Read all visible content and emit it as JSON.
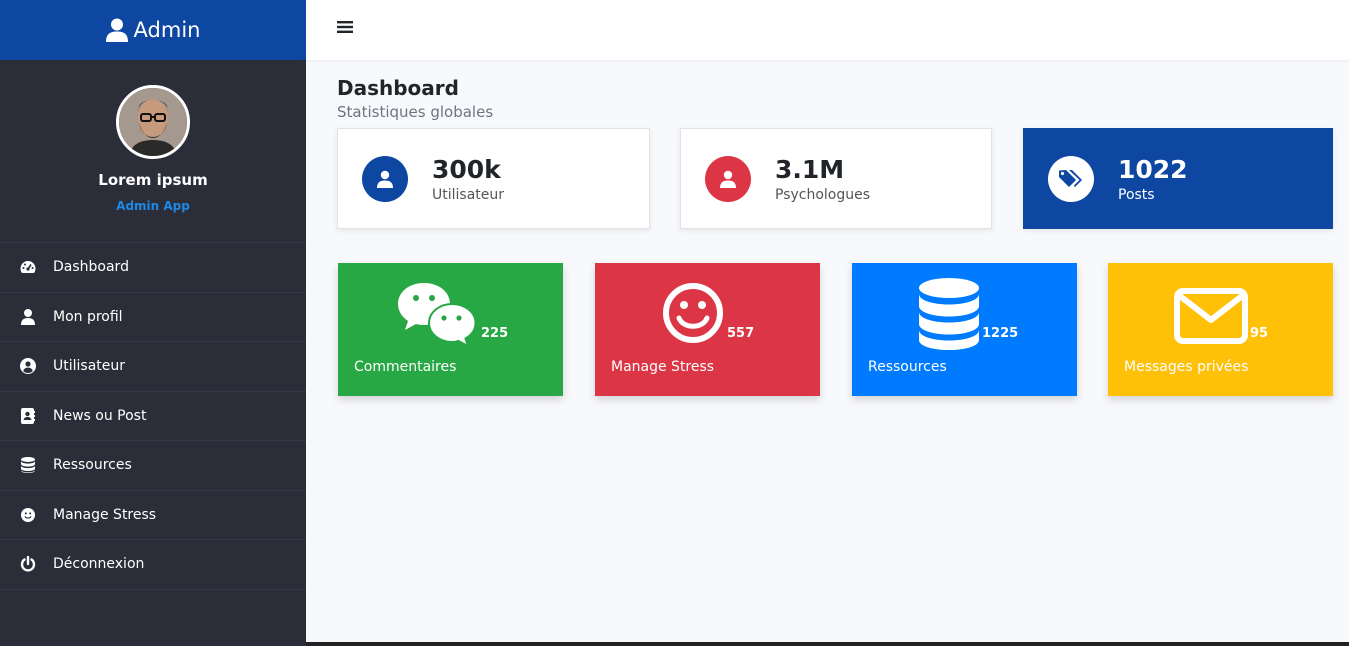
{
  "brand": {
    "title": "Admin",
    "color": "#0d47a1"
  },
  "profile": {
    "name": "Lorem ipsum",
    "role": "Admin App"
  },
  "menu": [
    {
      "label": "Dashboard",
      "icon": "tachometer-icon"
    },
    {
      "label": "Mon profil",
      "icon": "user-icon"
    },
    {
      "label": "Utilisateur",
      "icon": "user-circle-icon"
    },
    {
      "label": "News ou Post",
      "icon": "address-book-icon"
    },
    {
      "label": "Ressources",
      "icon": "database-icon"
    },
    {
      "label": "Manage Stress",
      "icon": "smile-icon"
    },
    {
      "label": "Déconnexion",
      "icon": "power-icon"
    }
  ],
  "header": {
    "title": "Dashboard",
    "subtitle": "Statistiques globales"
  },
  "stats": [
    {
      "value": "300k",
      "label": "Utilisateur",
      "icon": "user-icon",
      "color": "#0d47a1"
    },
    {
      "value": "3.1M",
      "label": "Psychologues",
      "icon": "user-icon",
      "color": "#dc3545"
    },
    {
      "value": "1022",
      "label": "Posts",
      "icon": "tags-icon",
      "color": "#0d47a1"
    }
  ],
  "tiles": [
    {
      "label": "Commentaires",
      "count": "225",
      "icon": "chat-bubbles-icon",
      "color": "#28a745"
    },
    {
      "label": "Manage Stress",
      "count": "557",
      "icon": "smile-icon",
      "color": "#dc3545"
    },
    {
      "label": "Ressources",
      "count": "1225",
      "icon": "database-icon",
      "color": "#007bff"
    },
    {
      "label": "Messages privées",
      "count": "95",
      "icon": "envelope-icon",
      "color": "#ffc107"
    }
  ]
}
